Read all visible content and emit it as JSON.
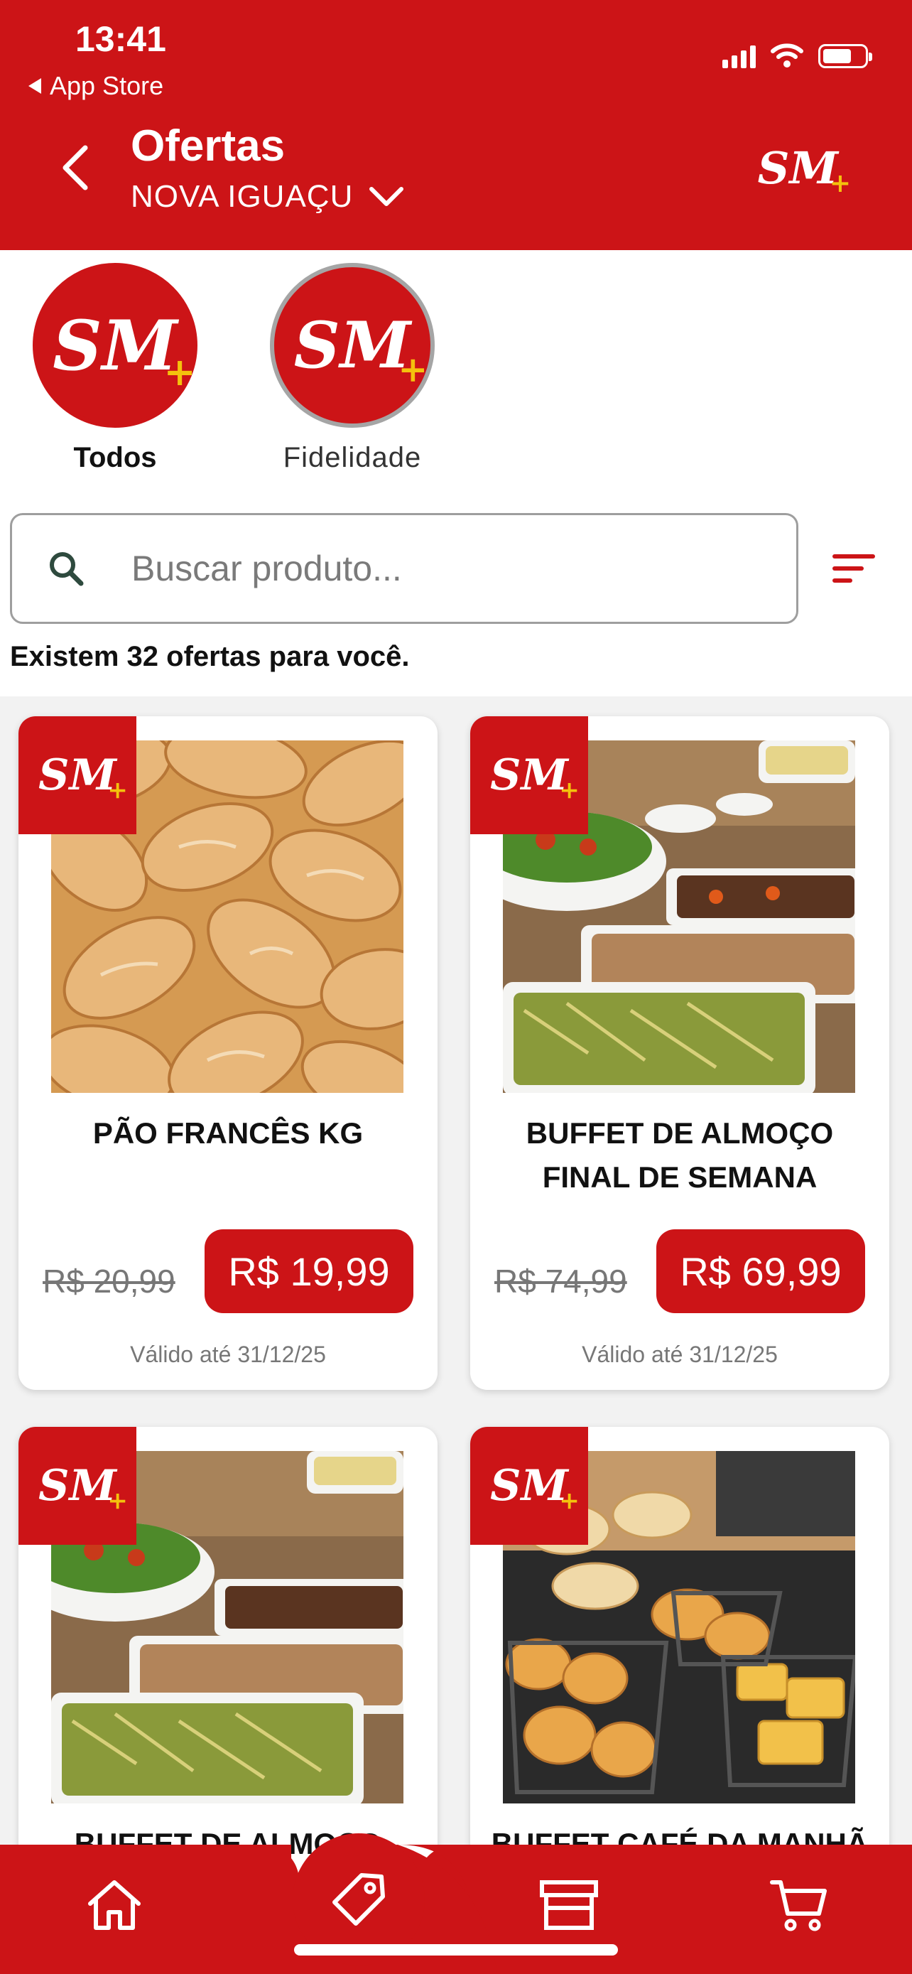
{
  "status_bar": {
    "time": "13:41",
    "back_app": "App Store"
  },
  "header": {
    "title": "Ofertas",
    "city": "NOVA IGUAÇU",
    "logo_text": "SM",
    "logo_plus": "+"
  },
  "categories": [
    {
      "label": "Todos",
      "logo_text": "SM",
      "logo_plus": "+",
      "selected": true
    },
    {
      "label": "Fidelidade",
      "logo_text": "SM",
      "logo_plus": "+",
      "selected": false
    }
  ],
  "search": {
    "placeholder": "Buscar produto..."
  },
  "offers_count_text": "Existem 32 ofertas para você.",
  "products": [
    {
      "name": "PÃO FRANCÊS KG",
      "old_price": "R$ 20,99",
      "new_price": "R$ 19,99",
      "valid": "Válido até 31/12/25",
      "image": "bread-rolls"
    },
    {
      "name": "BUFFET DE ALMOÇO FINAL DE SEMANA",
      "old_price": "R$ 74,99",
      "new_price": "R$ 69,99",
      "valid": "Válido até 31/12/25",
      "image": "lunch-buffet"
    },
    {
      "name": "BUFFET DE ALMOÇO",
      "image": "lunch-buffet"
    },
    {
      "name": "BUFFET CAFÉ DA MANHÃ",
      "image": "breakfast-buffet"
    }
  ],
  "colors": {
    "brand_red": "#cc1417",
    "accent_yellow": "#f4c20d"
  },
  "nav": [
    "home-icon",
    "tag-icon",
    "store-icon",
    "cart-icon"
  ]
}
